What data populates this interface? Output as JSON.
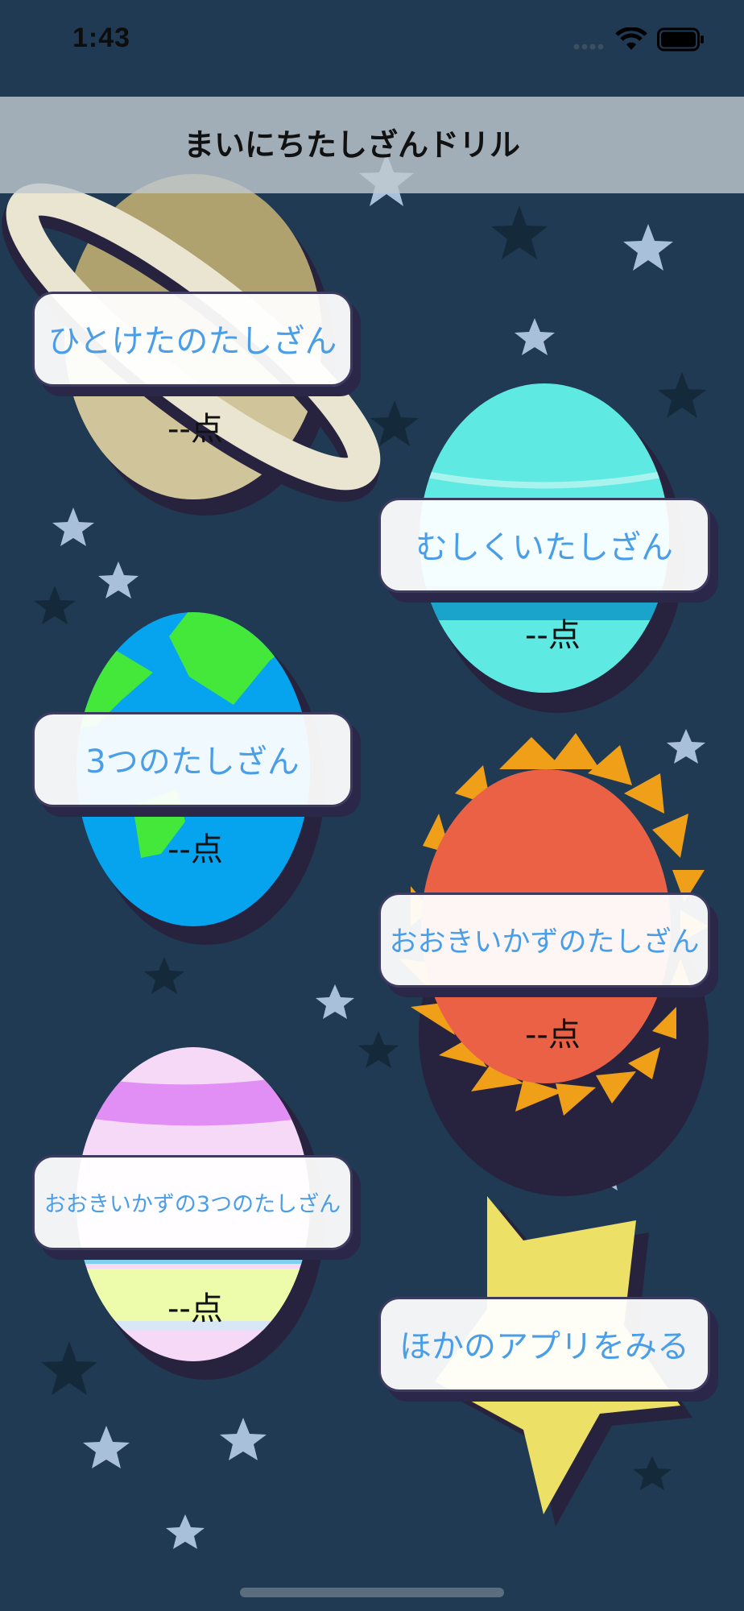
{
  "status_bar": {
    "time": "1:43",
    "icons": [
      "signal-dots-icon",
      "wifi-icon",
      "battery-icon"
    ]
  },
  "nav": {
    "title": "まいにちたしざんドリル"
  },
  "menu": [
    {
      "label": "ひとけたのたしざん",
      "score": "--点",
      "planet": "saturn"
    },
    {
      "label": "むしくいたしざん",
      "score": "--点",
      "planet": "neptune"
    },
    {
      "label": "3つのたしざん",
      "score": "--点",
      "planet": "earth"
    },
    {
      "label": "おおきいかずのたしざん",
      "score": "--点",
      "planet": "sun"
    },
    {
      "label": "おおきいかずの3つのたしざん",
      "score": "--点",
      "planet": "striped-planet"
    },
    {
      "label": "ほかのアプリをみる",
      "planet": "star"
    }
  ],
  "colors": {
    "background": "#1f3a52",
    "button_text": "#4a9ee8",
    "nav_bar": "#bec8ce"
  }
}
